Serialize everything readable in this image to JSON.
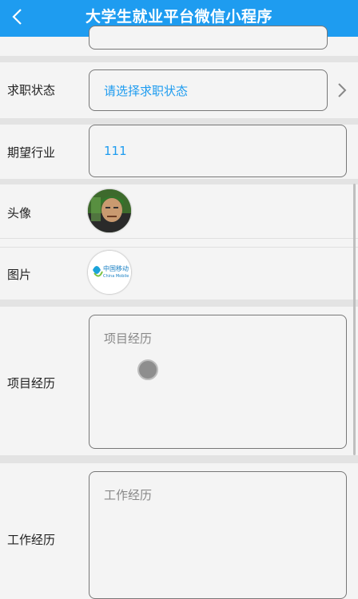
{
  "header": {
    "title": "大学生就业平台微信小程序",
    "back_icon": "chevron-left-icon"
  },
  "form": {
    "job_status": {
      "label": "求职状态",
      "placeholder": "请选择求职状态"
    },
    "industry": {
      "label": "期望行业",
      "value": "111"
    },
    "avatar": {
      "label": "头像"
    },
    "picture": {
      "label": "图片",
      "logo_text": "中国移动"
    },
    "project": {
      "label": "项目经历",
      "placeholder": "项目经历"
    },
    "work": {
      "label": "工作经历",
      "placeholder": "工作经历"
    }
  },
  "colors": {
    "accent": "#1e9cf0",
    "background": "#f4f4f4"
  }
}
